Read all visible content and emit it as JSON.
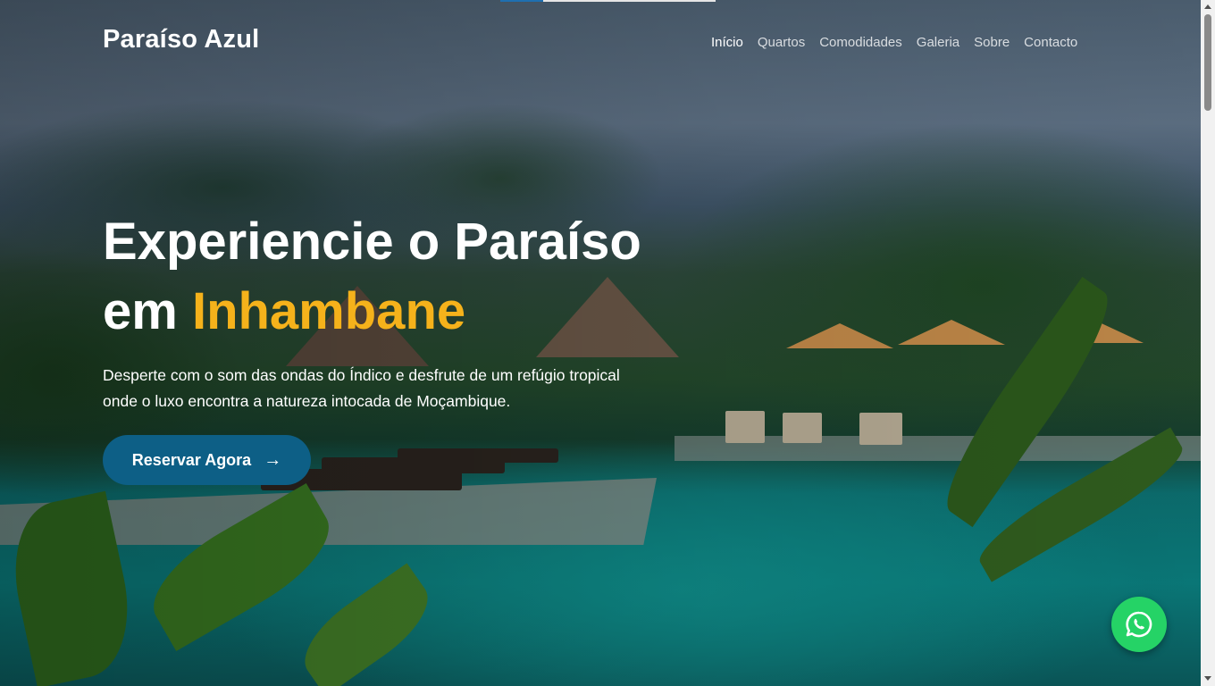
{
  "brand": "Paraíso Azul",
  "nav": {
    "items": [
      {
        "label": "Início",
        "active": true
      },
      {
        "label": "Quartos",
        "active": false
      },
      {
        "label": "Comodidades",
        "active": false
      },
      {
        "label": "Galeria",
        "active": false
      },
      {
        "label": "Sobre",
        "active": false
      },
      {
        "label": "Contacto",
        "active": false
      }
    ]
  },
  "hero": {
    "headline_line1": "Experiencie o Paraíso",
    "headline_line2_prefix": "em",
    "headline_highlight": "Inhambane",
    "subtitle_line1": "Desperte com o som das ondas do Índico e desfrute de um refúgio tropical",
    "subtitle_line2": "onde o luxo encontra a natureza intocada de Moçambique.",
    "cta_label": "Reservar Agora",
    "cta_icon": "arrow-right-icon"
  },
  "floating": {
    "icon": "whatsapp-icon"
  },
  "colors": {
    "accent": "#f5b21b",
    "cta_background": "#0d5f86",
    "whatsapp": "#25d366",
    "text": "#ffffff"
  }
}
